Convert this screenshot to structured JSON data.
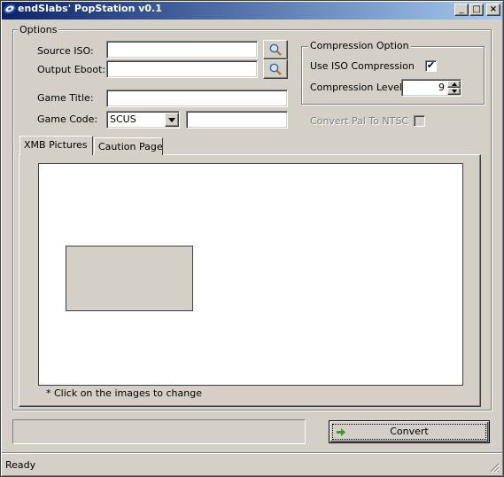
{
  "window": {
    "title": "endSlabs' PopStation  v0.1",
    "controls": {
      "minimize": "_",
      "maximize": "□",
      "close": "×"
    }
  },
  "options_group": {
    "title": "Options",
    "source_iso": {
      "label": "Source ISO:",
      "value": "",
      "browse_icon": "magnifier-icon"
    },
    "output_eboot": {
      "label": "Output Eboot:",
      "value": "",
      "browse_icon": "magnifier-icon"
    },
    "game_title": {
      "label": "Game Title:",
      "value": ""
    },
    "game_code": {
      "label": "Game Code:",
      "selected": "SCUS",
      "number_value": ""
    }
  },
  "compression_group": {
    "title": "Compression Option",
    "use_iso_compression": {
      "label": "Use ISO Compression",
      "checked": true,
      "check_mark": "✔"
    },
    "compression_level": {
      "label": "Compression Level:",
      "value": "9"
    }
  },
  "convert_pal": {
    "label": "Convert Pal To NTSC",
    "checked": false,
    "enabled": false
  },
  "tabs": [
    {
      "label": "XMB Pictures",
      "active": true
    },
    {
      "label": "Caution Page",
      "active": false
    }
  ],
  "xmb": {
    "hint": "* Click on the images to change"
  },
  "progress": {
    "value": 0
  },
  "convert_button": {
    "label": "Convert",
    "icon": "green-arrow-icon",
    "icon_color": "#3c9a2c"
  },
  "statusbar": {
    "text": "Ready"
  },
  "colors": {
    "face": "#d4d0c8",
    "title_start": "#0a246a",
    "title_end": "#a6caf0"
  }
}
